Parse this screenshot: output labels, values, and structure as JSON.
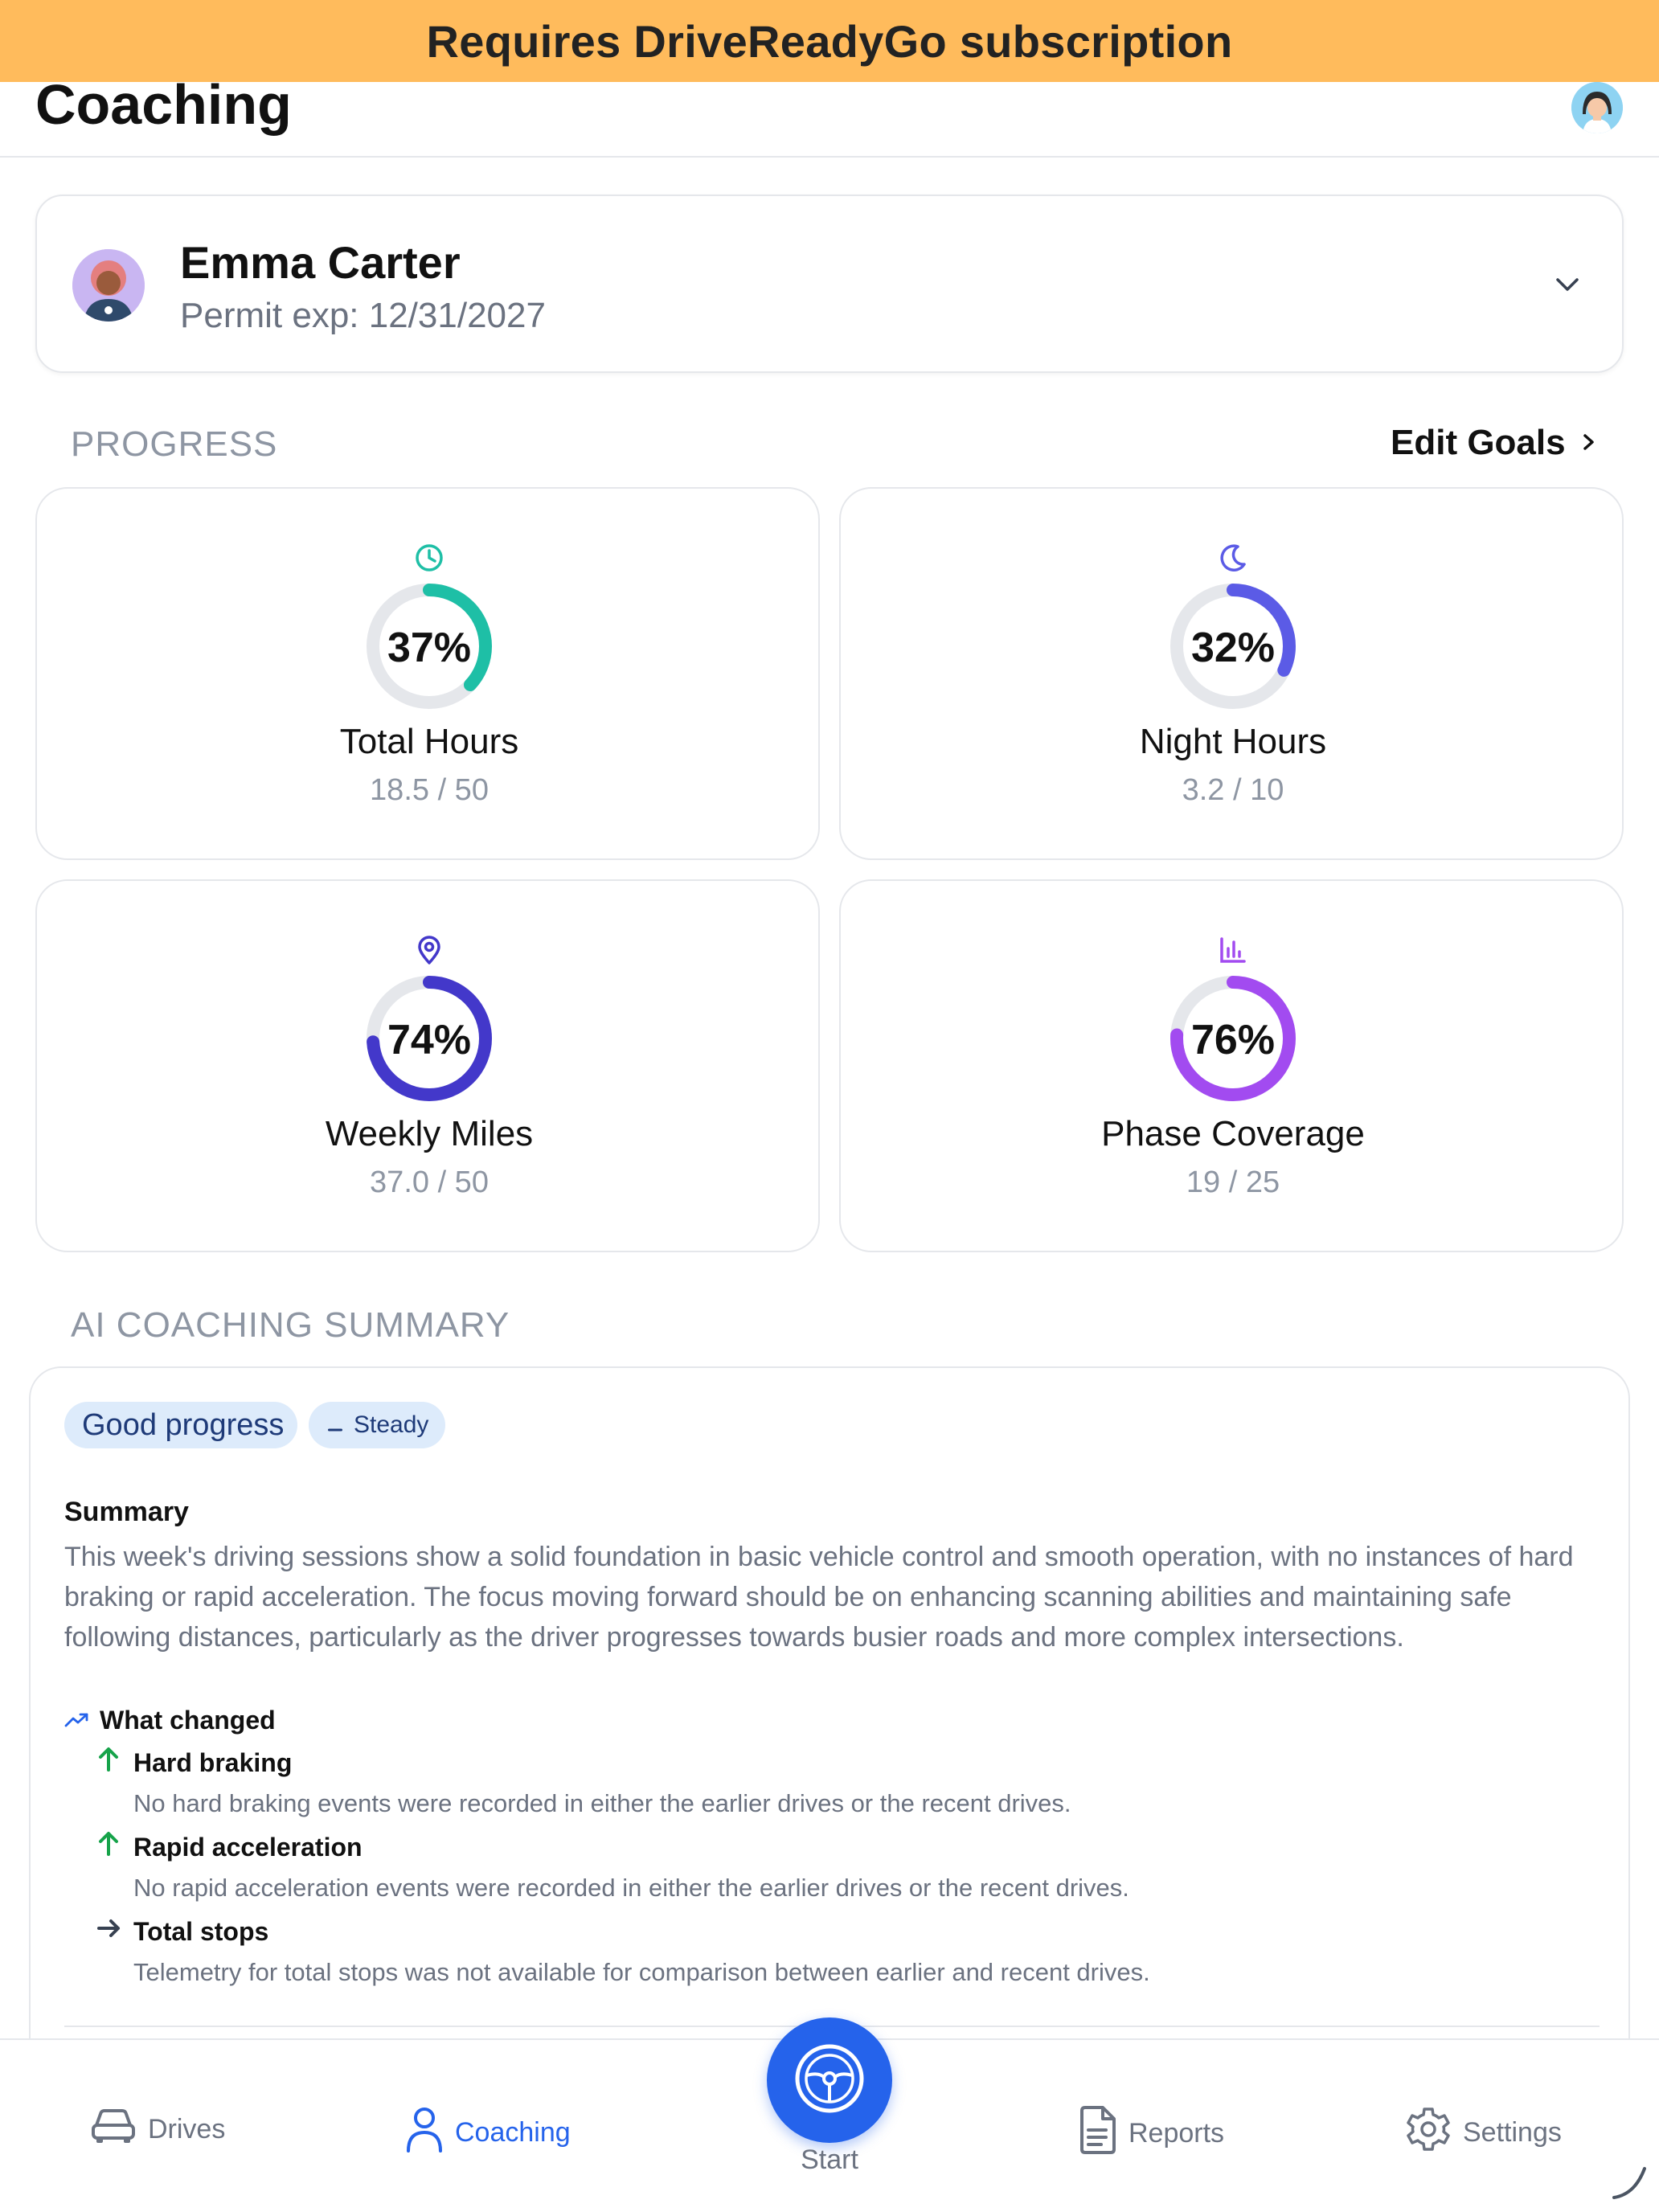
{
  "banner": {
    "text": "Requires DriveReadyGo subscription"
  },
  "header": {
    "title": "Coaching",
    "avatar_icon": "user-avatar-icon"
  },
  "student": {
    "name": "Emma Carter",
    "permit": "Permit exp: 12/31/2027",
    "avatar_icon": "student-avatar-icon",
    "chevron_icon": "chevron-down-icon"
  },
  "progress": {
    "section_label": "PROGRESS",
    "edit_goals": "Edit Goals",
    "cards": [
      {
        "label": "Total Hours",
        "percent_text": "37%",
        "value": 0.37,
        "sub": "18.5 / 50",
        "icon": "clock-icon",
        "color": "#1EBFA6"
      },
      {
        "label": "Night Hours",
        "percent_text": "32%",
        "value": 0.32,
        "sub": "3.2 / 10",
        "icon": "moon-icon",
        "color": "#5B5BE6"
      },
      {
        "label": "Weekly Miles",
        "percent_text": "74%",
        "value": 0.74,
        "sub": "37.0 / 50",
        "icon": "location-pin-icon",
        "color": "#4338CA"
      },
      {
        "label": "Phase Coverage",
        "percent_text": "76%",
        "value": 0.76,
        "sub": "19 / 25",
        "icon": "bar-chart-icon",
        "color": "#A24BF0"
      }
    ]
  },
  "ai_summary": {
    "section_label": "AI COACHING SUMMARY",
    "badge_status": "Good progress",
    "badge_trend": "Steady",
    "summary_heading": "Summary",
    "summary_text": "This week's driving sessions show a solid foundation in basic vehicle control and smooth operation, with no instances of hard braking or rapid acceleration. The focus moving forward should be on enhancing scanning abilities and maintaining safe following distances, particularly as the driver progresses towards busier roads and more complex intersections.",
    "changed_heading": "What changed",
    "changes": [
      {
        "title": "Hard braking",
        "desc": "No hard braking events were recorded in either the earlier drives or the recent drives.",
        "icon": "arrow-up-icon",
        "color": "#16A34A"
      },
      {
        "title": "Rapid acceleration",
        "desc": "No rapid acceleration events were recorded in either the earlier drives or the recent drives.",
        "icon": "arrow-up-icon",
        "color": "#16A34A"
      },
      {
        "title": "Total stops",
        "desc": "Telemetry for total stops was not available for comparison between earlier and recent drives.",
        "icon": "arrow-right-icon",
        "color": "#374151"
      }
    ]
  },
  "tabbar": {
    "drives": "Drives",
    "coaching": "Coaching",
    "start": "Start",
    "reports": "Reports",
    "settings": "Settings",
    "active": "coaching",
    "accent_color": "#2563EB"
  }
}
